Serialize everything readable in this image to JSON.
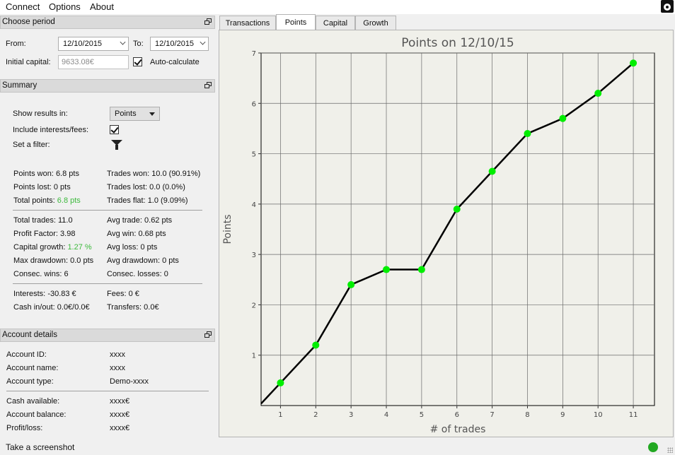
{
  "menu": [
    "Connect",
    "Options",
    "About"
  ],
  "period": {
    "header": "Choose period",
    "from_label": "From:",
    "from_value": "12/10/2015",
    "to_label": "To:",
    "to_value": "12/10/2015",
    "capital_label": "Initial capital:",
    "capital_placeholder": "9633.08€",
    "auto_label": "Auto-calculate"
  },
  "summary": {
    "header": "Summary",
    "show_label": "Show results in:",
    "show_value": "Points",
    "include_label": "Include interests/fees:",
    "filter_label": "Set a filter:",
    "left1": [
      {
        "label": "Points won:",
        "value": "6.8 pts"
      },
      {
        "label": "Points lost:",
        "value": "0 pts"
      },
      {
        "label": "Total points:",
        "value": "6.8 pts"
      }
    ],
    "right1": [
      {
        "label": "Trades won:",
        "value": "10.0 (90.91%)"
      },
      {
        "label": "Trades lost:",
        "value": "0.0 (0.0%)"
      },
      {
        "label": "Trades flat:",
        "value": "1.0 (9.09%)"
      }
    ],
    "left2": [
      {
        "label": "Total trades:",
        "value": "11.0"
      },
      {
        "label": "Profit Factor:",
        "value": "3.98"
      },
      {
        "label": "Capital growth:",
        "value": "1.27 %"
      },
      {
        "label": "Max drawdown:",
        "value": "0.0 pts"
      },
      {
        "label": "Consec. wins:",
        "value": "6"
      }
    ],
    "right2": [
      {
        "label": "Avg trade:",
        "value": "0.62 pts"
      },
      {
        "label": "Avg win:",
        "value": "0.68 pts"
      },
      {
        "label": "Avg loss:",
        "value": "0 pts"
      },
      {
        "label": "Avg drawdown:",
        "value": "0 pts"
      },
      {
        "label": "Consec. losses:",
        "value": "0"
      }
    ],
    "left3": [
      {
        "label": "Interests:",
        "value": "-30.83 €"
      },
      {
        "label": "Cash in/out:",
        "value": "0.0€/0.0€"
      }
    ],
    "right3": [
      {
        "label": "Fees:",
        "value": "0 €"
      },
      {
        "label": "Transfers:",
        "value": "0.0€"
      }
    ],
    "accent_color": "#3cb93c"
  },
  "account": {
    "header": "Account details",
    "rows1": [
      {
        "label": "Account ID:",
        "value": "xxxx"
      },
      {
        "label": "Account name:",
        "value": "xxxx"
      },
      {
        "label": "Account type:",
        "value": "Demo-xxxx"
      }
    ],
    "rows2": [
      {
        "label": "Cash available:",
        "value": "xxxx€"
      },
      {
        "label": "Account balance:",
        "value": "xxxx€"
      },
      {
        "label": "Profit/loss:",
        "value": "xxxx€"
      }
    ]
  },
  "tabs": [
    "Transactions",
    "Points",
    "Capital",
    "Growth"
  ],
  "active_tab": "Points",
  "status": {
    "text": "Take a screenshot",
    "indicator_color": "#22a822"
  },
  "chart_data": {
    "type": "line",
    "title": "Points on 12/10/15",
    "xlabel": "# of trades",
    "ylabel": "Points",
    "x": [
      1,
      2,
      3,
      4,
      5,
      6,
      7,
      8,
      9,
      10,
      11
    ],
    "xlim": [
      0.45,
      11.6
    ],
    "ylim": [
      0,
      7
    ],
    "yticks": [
      1,
      2,
      3,
      4,
      5,
      6,
      7
    ],
    "series": [
      {
        "values": [
          0.45,
          1.2,
          2.4,
          2.7,
          2.7,
          3.9,
          4.65,
          5.4,
          5.7,
          6.2,
          6.8
        ],
        "line_color": "#000000",
        "marker_color": "#00ee00"
      }
    ],
    "grid": true,
    "legend": "none"
  }
}
